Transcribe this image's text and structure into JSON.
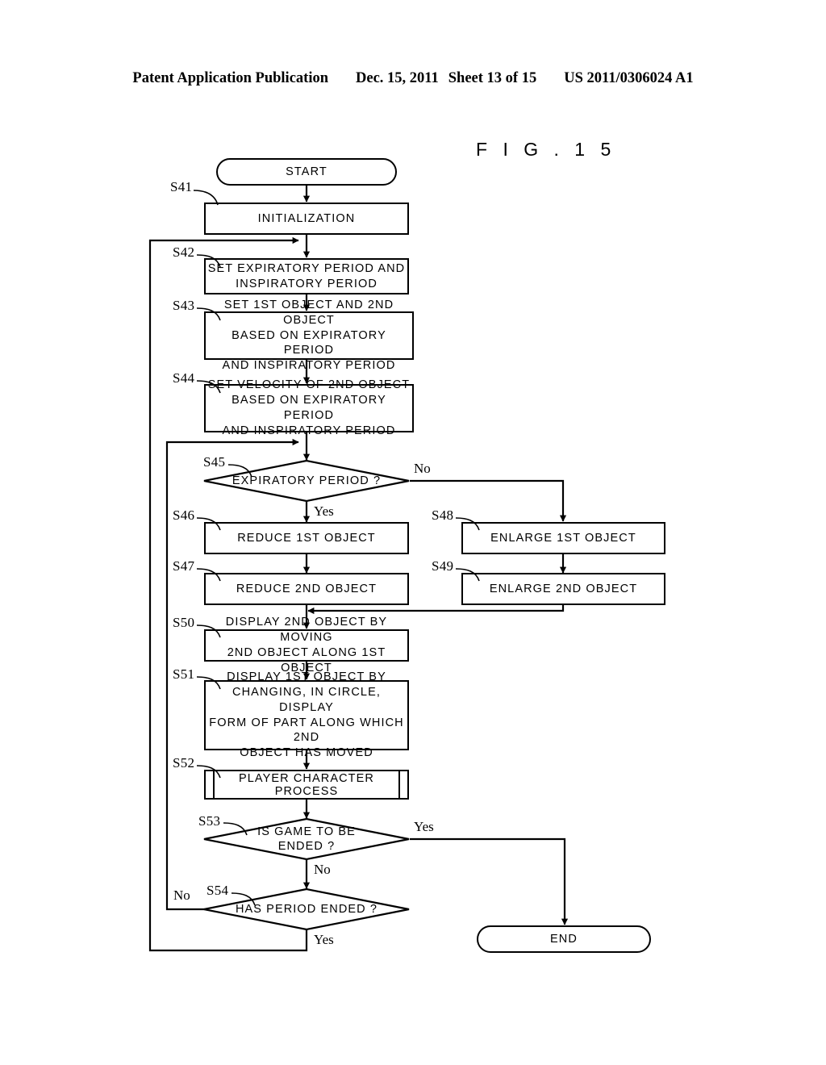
{
  "header": {
    "publication": "Patent Application Publication",
    "date": "Dec. 15, 2011",
    "sheet": "Sheet 13 of 15",
    "patent_number": "US 2011/0306024 A1"
  },
  "figure": {
    "title": "F I G .  1 5"
  },
  "flowchart": {
    "nodes": {
      "start": {
        "id": "START",
        "label": "START",
        "shape": "terminal"
      },
      "s41": {
        "id": "S41",
        "label": "INITIALIZATION",
        "shape": "process"
      },
      "s42": {
        "id": "S42",
        "label": "SET EXPIRATORY PERIOD AND\nINSPIRATORY PERIOD",
        "shape": "process"
      },
      "s43": {
        "id": "S43",
        "label": "SET 1ST OBJECT AND 2ND OBJECT\nBASED ON EXPIRATORY PERIOD\nAND INSPIRATORY PERIOD",
        "shape": "process"
      },
      "s44": {
        "id": "S44",
        "label": "SET VELOCITY OF 2ND OBJECT\nBASED ON EXPIRATORY PERIOD\nAND INSPIRATORY PERIOD",
        "shape": "process"
      },
      "s45": {
        "id": "S45",
        "label": "EXPIRATORY PERIOD ?",
        "shape": "decision"
      },
      "s46": {
        "id": "S46",
        "label": "REDUCE 1ST OBJECT",
        "shape": "process"
      },
      "s47": {
        "id": "S47",
        "label": "REDUCE 2ND OBJECT",
        "shape": "process"
      },
      "s48": {
        "id": "S48",
        "label": "ENLARGE 1ST OBJECT",
        "shape": "process"
      },
      "s49": {
        "id": "S49",
        "label": "ENLARGE 2ND OBJECT",
        "shape": "process"
      },
      "s50": {
        "id": "S50",
        "label": "DISPLAY 2ND OBJECT BY MOVING\n2ND OBJECT ALONG 1ST OBJECT",
        "shape": "process"
      },
      "s51": {
        "id": "S51",
        "label": "DISPLAY 1ST OBJECT BY\nCHANGING, IN CIRCLE, DISPLAY\nFORM OF PART ALONG WHICH 2ND\nOBJECT HAS MOVED",
        "shape": "process"
      },
      "s52": {
        "id": "S52",
        "label": "PLAYER CHARACTER PROCESS",
        "shape": "subroutine"
      },
      "s53": {
        "id": "S53",
        "label": "IS GAME TO BE\nENDED ?",
        "shape": "decision"
      },
      "s54": {
        "id": "S54",
        "label": "HAS PERIOD ENDED ?",
        "shape": "decision"
      },
      "end": {
        "id": "END",
        "label": "END",
        "shape": "terminal"
      }
    },
    "branches": {
      "s45_yes": "Yes",
      "s45_no": "No",
      "s53_yes": "Yes",
      "s53_no": "No",
      "s54_yes": "Yes",
      "s54_no": "No"
    }
  },
  "style": {
    "ink": "#000000",
    "paper": "#ffffff"
  }
}
